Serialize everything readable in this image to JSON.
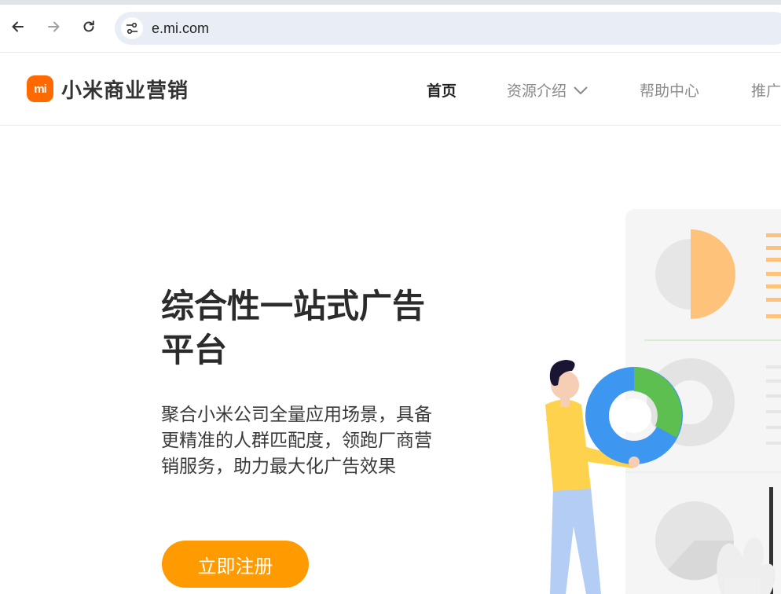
{
  "browser": {
    "url": "e.mi.com",
    "icons": {
      "back": "arrow-left-icon",
      "forward": "arrow-right-icon",
      "reload": "reload-icon",
      "site_settings": "tune-icon"
    }
  },
  "header": {
    "logo_mark": "mi",
    "logo_text": "小米商业营销",
    "nav": [
      {
        "label": "首页",
        "active": true
      },
      {
        "label": "资源介绍",
        "has_dropdown": true
      },
      {
        "label": "帮助中心"
      },
      {
        "label": "推广"
      }
    ]
  },
  "hero": {
    "title": "综合性一站式广告平台",
    "subtitle": "聚合小米公司全量应用场景，具备更精准的人群匹配度，领跑厂商营销服务，助力最大化广告效果",
    "cta_label": "立即注册"
  },
  "colors": {
    "accent": "#ff9a00",
    "brand": "#ff6900",
    "donut_blue": "#3d96f0",
    "donut_green": "#5cbf4f",
    "peach": "#ffc27a",
    "shirt_yellow": "#ffd24d",
    "pants_blue": "#b3cdf4"
  }
}
